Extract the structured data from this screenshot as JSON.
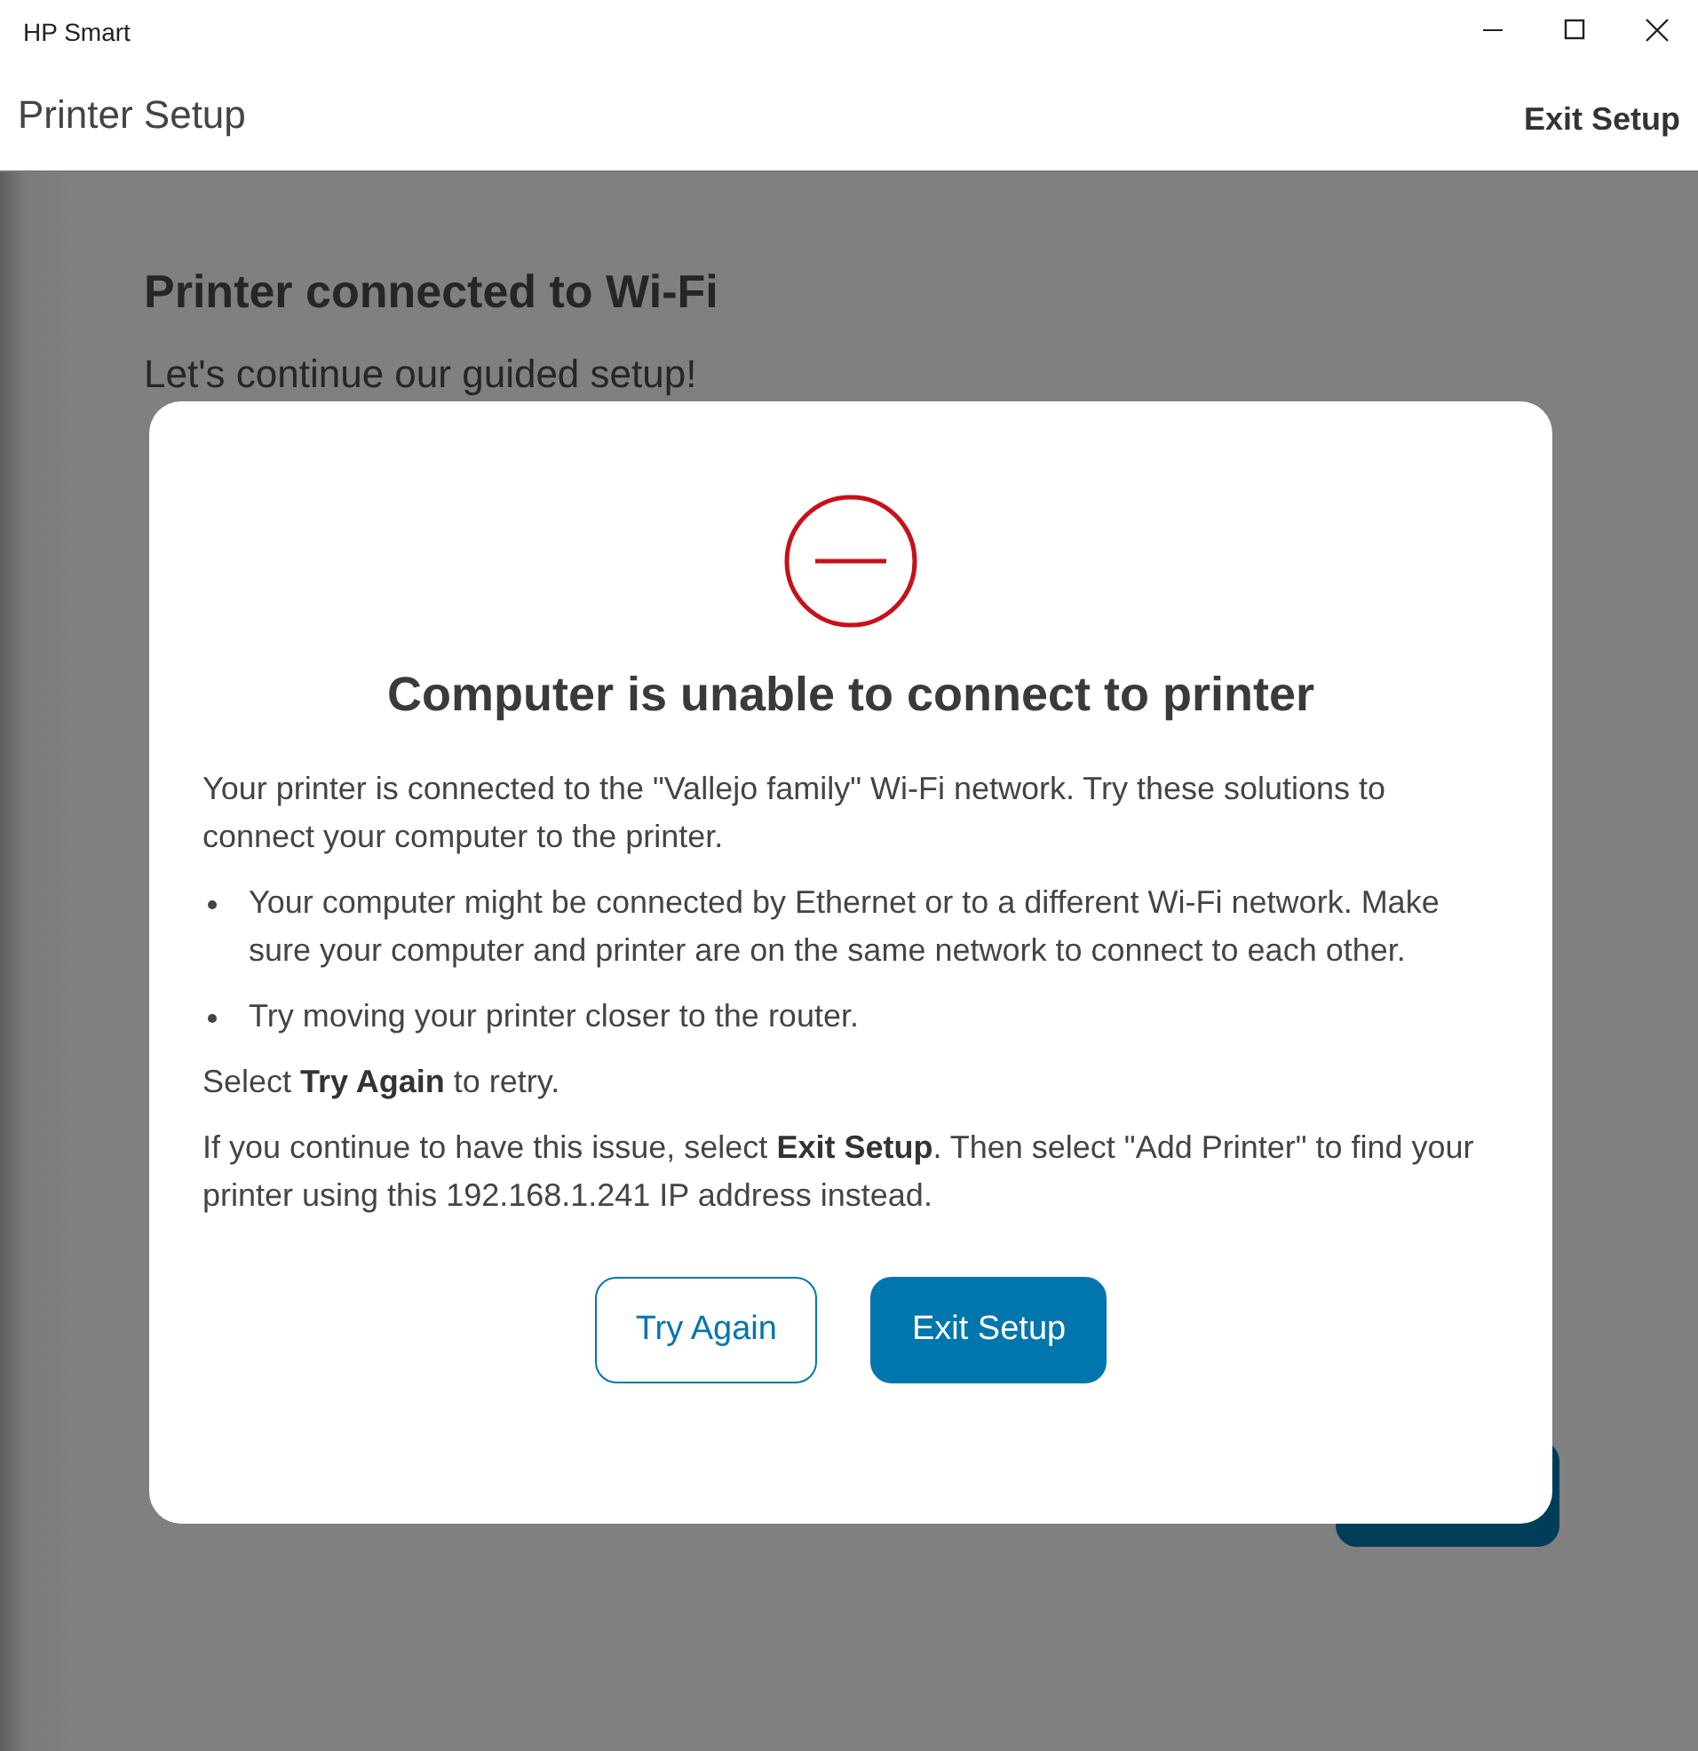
{
  "window": {
    "title": "HP Smart"
  },
  "header": {
    "title": "Printer Setup",
    "exit_link": "Exit Setup"
  },
  "page": {
    "heading": "Printer connected to Wi-Fi",
    "subtitle": "Let's continue our guided setup!"
  },
  "dialog": {
    "title": "Computer is unable to connect to printer",
    "intro": "Your printer is connected to the \"Vallejo family\" Wi-Fi network. Try these solutions to connect your computer to the printer.",
    "bullets": [
      "Your computer might be connected by Ethernet or to a different Wi-Fi network. Make sure your computer and printer are on the same network to connect to each other.",
      "Try moving your printer closer to the router."
    ],
    "paragraphs": [
      "Select **Try Again** to retry.",
      "If you continue to have this issue, select **Exit Setup**. Then select \"Add Printer\" to find your printer using this 192.168.1.241 IP address instead."
    ],
    "buttons": [
      {
        "label": "Try Again",
        "kind": "secondary"
      },
      {
        "label": "Exit Setup",
        "kind": "primary"
      }
    ]
  }
}
